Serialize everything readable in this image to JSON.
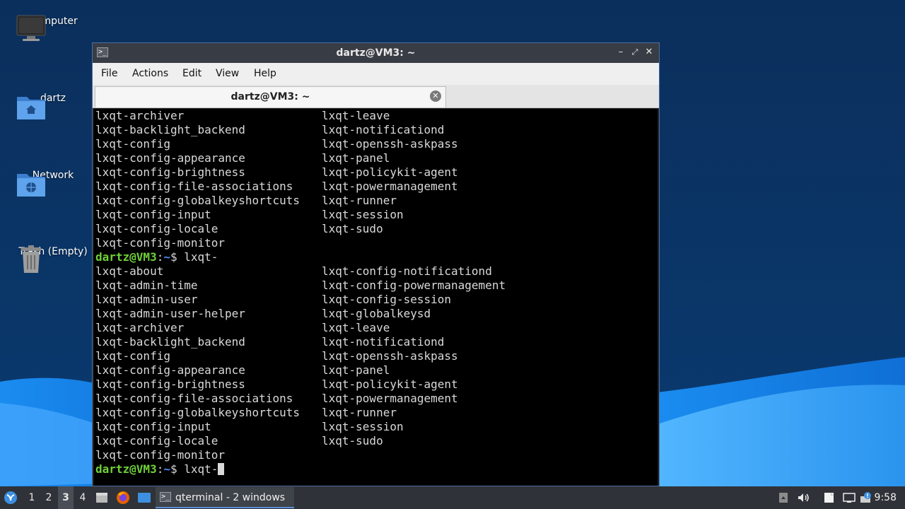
{
  "desktop": {
    "icons": [
      {
        "label": "Computer",
        "icon": "computer-icon"
      },
      {
        "label": "dartz",
        "icon": "home-folder-icon"
      },
      {
        "label": "Network",
        "icon": "network-folder-icon"
      },
      {
        "label": "Trash (Empty)",
        "icon": "trash-icon"
      }
    ]
  },
  "window": {
    "title": "dartz@VM3: ~",
    "menu": [
      "File",
      "Actions",
      "Edit",
      "View",
      "Help"
    ],
    "tab_label": "dartz@VM3: ~",
    "terminal": {
      "prompt_user": "dartz@VM3",
      "prompt_sep": ":",
      "prompt_path": "~",
      "prompt_symbol": "$ ",
      "command": "lxqt-",
      "block_a": [
        [
          "lxqt-archiver",
          "lxqt-leave"
        ],
        [
          "lxqt-backlight_backend",
          "lxqt-notificationd"
        ],
        [
          "lxqt-config",
          "lxqt-openssh-askpass"
        ],
        [
          "lxqt-config-appearance",
          "lxqt-panel"
        ],
        [
          "lxqt-config-brightness",
          "lxqt-policykit-agent"
        ],
        [
          "lxqt-config-file-associations",
          "lxqt-powermanagement"
        ],
        [
          "lxqt-config-globalkeyshortcuts",
          "lxqt-runner"
        ],
        [
          "lxqt-config-input",
          "lxqt-session"
        ],
        [
          "lxqt-config-locale",
          "lxqt-sudo"
        ],
        [
          "lxqt-config-monitor",
          ""
        ]
      ],
      "block_b": [
        [
          "lxqt-about",
          "lxqt-config-notificationd"
        ],
        [
          "lxqt-admin-time",
          "lxqt-config-powermanagement"
        ],
        [
          "lxqt-admin-user",
          "lxqt-config-session"
        ],
        [
          "lxqt-admin-user-helper",
          "lxqt-globalkeysd"
        ],
        [
          "lxqt-archiver",
          "lxqt-leave"
        ],
        [
          "lxqt-backlight_backend",
          "lxqt-notificationd"
        ],
        [
          "lxqt-config",
          "lxqt-openssh-askpass"
        ],
        [
          "lxqt-config-appearance",
          "lxqt-panel"
        ],
        [
          "lxqt-config-brightness",
          "lxqt-policykit-agent"
        ],
        [
          "lxqt-config-file-associations",
          "lxqt-powermanagement"
        ],
        [
          "lxqt-config-globalkeyshortcuts",
          "lxqt-runner"
        ],
        [
          "lxqt-config-input",
          "lxqt-session"
        ],
        [
          "lxqt-config-locale",
          "lxqt-sudo"
        ],
        [
          "lxqt-config-monitor",
          ""
        ]
      ]
    }
  },
  "taskbar": {
    "desktops": [
      "1",
      "2",
      "3",
      "4"
    ],
    "active_desktop": "3",
    "task_label": "qterminal - 2 windows",
    "clock": "9:58"
  },
  "colors": {
    "prompt_user": "#6fd13a",
    "prompt_path": "#4f8ff0",
    "terminal_bg": "#000000",
    "desktop_bg": "#0b2f5c"
  }
}
